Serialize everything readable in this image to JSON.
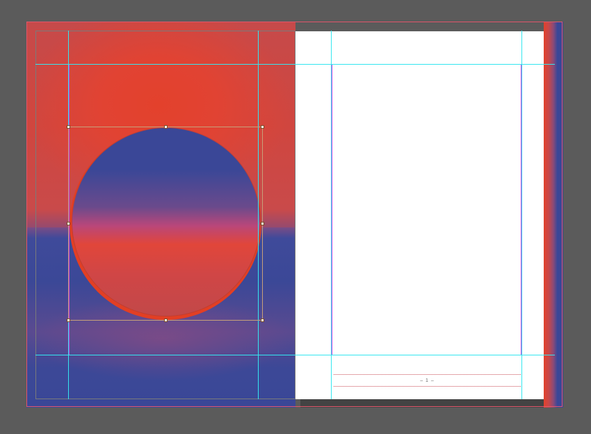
{
  "document": {
    "page_number_marker": "– 1 –"
  },
  "colors": {
    "pasteboard": "#5b5b5b",
    "artwork_red": "#e3412c",
    "artwork_blue": "#3a4797",
    "guide_cyan": "#34e6f0",
    "margin_magenta": "#c341e0",
    "bleed_red": "#e0566a"
  }
}
